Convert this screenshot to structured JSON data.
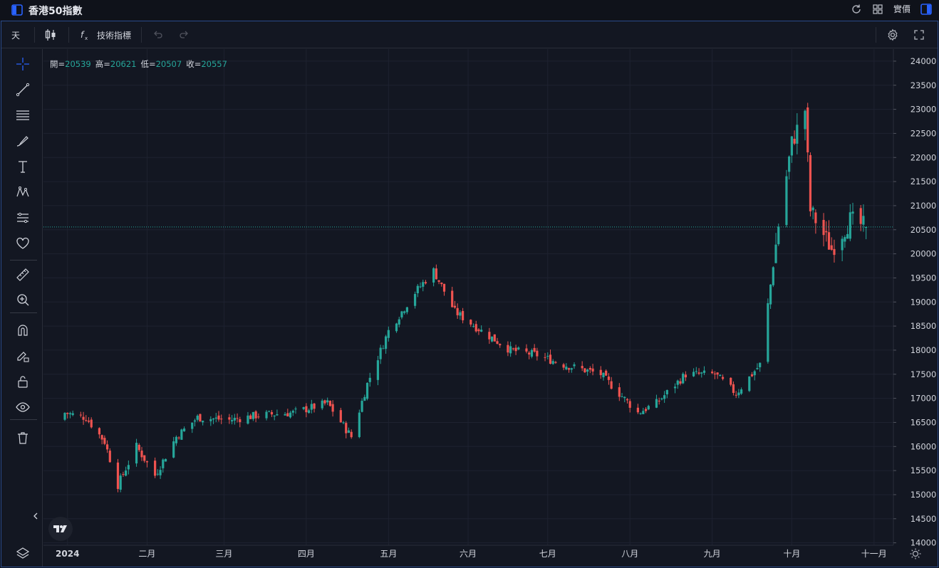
{
  "window": {
    "title": "香港50指數",
    "realtime_label": "實價"
  },
  "toolbar": {
    "interval": "天",
    "indicators_label": "技術指標"
  },
  "sidebar": {
    "tools": [
      "crosshair-icon",
      "trendline-icon",
      "fib-icon",
      "brush-icon",
      "text-icon",
      "pattern-icon",
      "prediction-icon",
      "favorite-icon",
      "ruler-icon",
      "zoom-icon",
      "magnet-icon",
      "lock-drawing-icon",
      "unlock-icon",
      "eye-icon",
      "trash-icon"
    ]
  },
  "ohlc": {
    "open_label": "開=",
    "open": "20539",
    "high_label": "高=",
    "high": "20621",
    "low_label": "低=",
    "low": "20507",
    "close_label": "收=",
    "close": "20557"
  },
  "colors": {
    "up": "#26a69a",
    "down": "#ef5350",
    "background": "#131722",
    "grid": "#1e2230",
    "accent": "#2962ff"
  },
  "chart_data": {
    "type": "candlestick",
    "symbol": "香港50指數",
    "interval": "1D",
    "ylim": [
      13950,
      24250
    ],
    "y_ticks": [
      "24000",
      "23500",
      "23000",
      "22500",
      "22000",
      "21500",
      "21000",
      "20500",
      "20000",
      "19500",
      "19000",
      "18500",
      "18000",
      "17500",
      "17000",
      "16500",
      "16000",
      "15500",
      "15000",
      "14500",
      "14000"
    ],
    "x_ticks": [
      "2024",
      "二月",
      "三月",
      "四月",
      "五月",
      "六月",
      "七月",
      "八月",
      "九月",
      "十月",
      "十一月"
    ],
    "last_price": "20557",
    "anchors": [
      {
        "date": "2024-01-02",
        "close": 16700
      },
      {
        "date": "2024-01-10",
        "close": 16600
      },
      {
        "date": "2024-01-17",
        "close": 16100
      },
      {
        "date": "2024-01-22",
        "close": 15200
      },
      {
        "date": "2024-01-29",
        "close": 16000
      },
      {
        "date": "2024-02-05",
        "close": 15400
      },
      {
        "date": "2024-02-13",
        "close": 16200
      },
      {
        "date": "2024-02-21",
        "close": 16600
      },
      {
        "date": "2024-03-04",
        "close": 16550
      },
      {
        "date": "2024-03-15",
        "close": 16650
      },
      {
        "date": "2024-03-28",
        "close": 16700
      },
      {
        "date": "2024-04-10",
        "close": 16900
      },
      {
        "date": "2024-04-19",
        "close": 16200
      },
      {
        "date": "2024-04-25",
        "close": 17300
      },
      {
        "date": "2024-05-03",
        "close": 18400
      },
      {
        "date": "2024-05-13",
        "close": 19200
      },
      {
        "date": "2024-05-20",
        "close": 19650
      },
      {
        "date": "2024-05-28",
        "close": 18800
      },
      {
        "date": "2024-06-07",
        "close": 18400
      },
      {
        "date": "2024-06-18",
        "close": 18000
      },
      {
        "date": "2024-06-28",
        "close": 17900
      },
      {
        "date": "2024-07-08",
        "close": 17700
      },
      {
        "date": "2024-07-22",
        "close": 17500
      },
      {
        "date": "2024-08-05",
        "close": 16700
      },
      {
        "date": "2024-08-12",
        "close": 16900
      },
      {
        "date": "2024-08-23",
        "close": 17500
      },
      {
        "date": "2024-09-03",
        "close": 17500
      },
      {
        "date": "2024-09-11",
        "close": 17100
      },
      {
        "date": "2024-09-20",
        "close": 17700
      },
      {
        "date": "2024-09-27",
        "close": 20600
      },
      {
        "date": "2024-10-02",
        "close": 22300
      },
      {
        "date": "2024-10-07",
        "close": 23000
      },
      {
        "date": "2024-10-09",
        "close": 20900
      },
      {
        "date": "2024-10-17",
        "close": 20100
      },
      {
        "date": "2024-10-24",
        "close": 20700
      },
      {
        "date": "2024-10-30",
        "close": 20557
      }
    ]
  }
}
